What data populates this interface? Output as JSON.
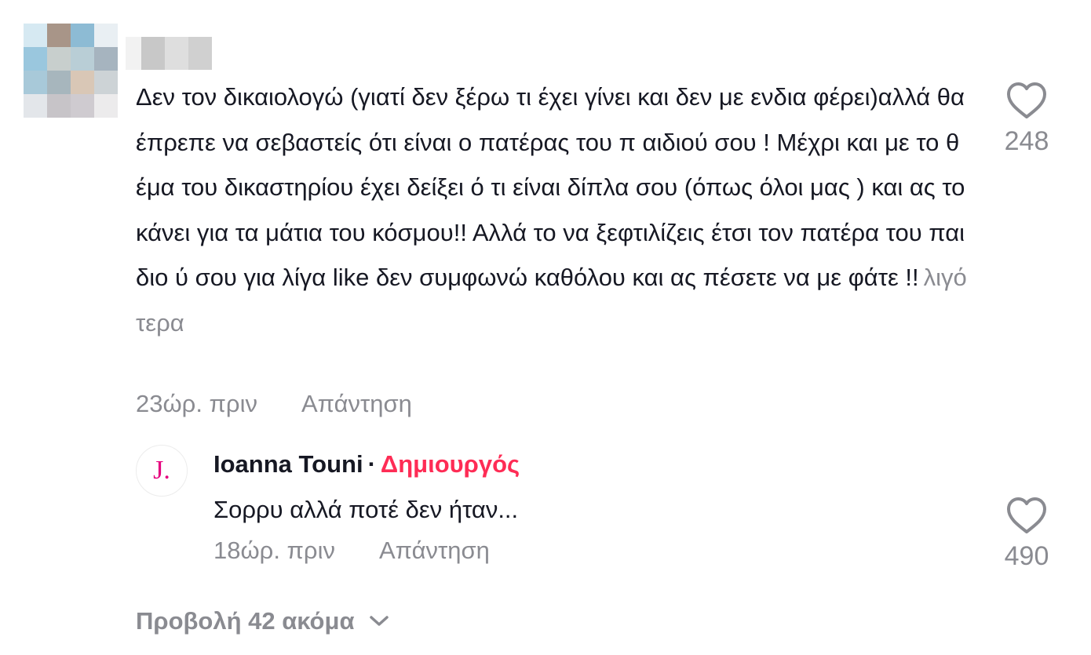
{
  "comment": {
    "avatar_colors": [
      "#d6e9f2",
      "#a89588",
      "#8dbbd4",
      "#e9eff3",
      "#9ac7de",
      "#c8cfcd",
      "#b9ced6",
      "#a6b4bf",
      "#a8c9d9",
      "#a7b6bd",
      "#d9c7b6",
      "#cdd3d6",
      "#e3e6ea",
      "#c7c4c8",
      "#cfcbd0",
      "#ecebec"
    ],
    "username_colors": [
      "#f2f2f2",
      "#c8c8c8",
      "#dedede",
      "#d0d0d0"
    ],
    "text": "Δεν τον δικαιολογώ (γιατί δεν ξέρω τι έχει γίνει και δεν με ενδια φέρει)αλλά θα έπρεπε να σεβαστείς ότι είναι ο πατέρας του π αιδιού σου ! Μέχρι και με το θέμα του δικαστηρίου έχει δείξει ό τι είναι δίπλα σου (όπως όλοι μας ) και ας το κάνει για τα μάτια του κόσμου!! Αλλά το να ξεφτιλίζεις έτσι τον πατέρα του παιδιο ύ σου για λίγα like δεν συμφωνώ καθόλου και ας πέσετε να με φάτε !!",
    "less_label": "λιγότερα",
    "time": "23ώρ. πριν",
    "reply_label": "Απάντηση",
    "like_icon": "heart-outline-icon",
    "likes": "248"
  },
  "reply": {
    "avatar_letter": "J.",
    "avatar_color": "#e6007e",
    "author": "Ioanna Touni",
    "separator": "·",
    "creator_label": "Δημιουργός",
    "creator_color": "#fe2c55",
    "text": "Σορρυ αλλά ποτέ δεν ήταν...",
    "time": "18ώρ. πριν",
    "reply_label": "Απάντηση",
    "like_icon": "heart-outline-icon",
    "likes": "490"
  },
  "view_more": {
    "label": "Προβολή 42 ακόμα",
    "icon": "chevron-down-icon"
  }
}
